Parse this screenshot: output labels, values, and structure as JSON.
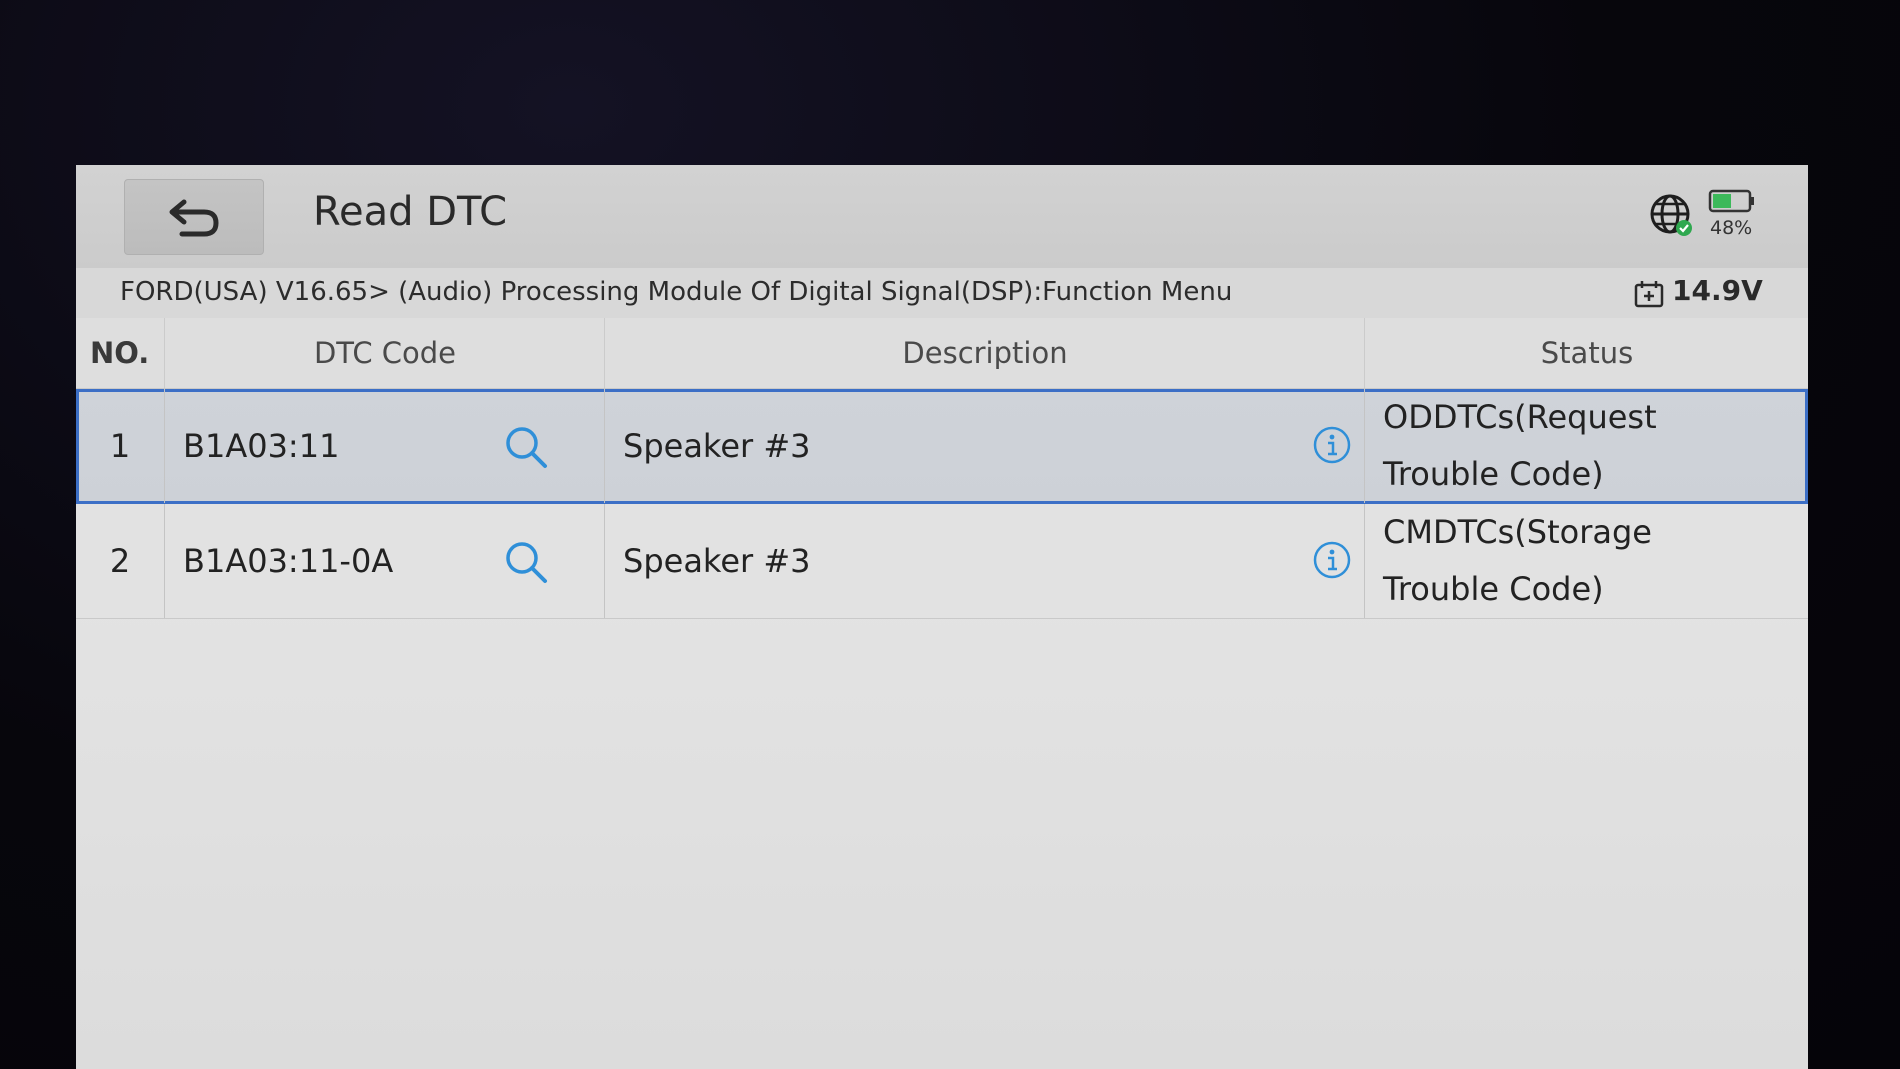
{
  "header": {
    "title": "Read DTC",
    "battery_percent": "48%"
  },
  "breadcrumb": {
    "path": "FORD(USA) V16.65> (Audio) Processing Module Of Digital Signal(DSP):Function Menu",
    "voltage": "14.9V"
  },
  "table": {
    "columns": [
      "NO.",
      "DTC Code",
      "Description",
      "Status"
    ],
    "rows": [
      {
        "no": "1",
        "code": "B1A03:11",
        "description": "Speaker #3",
        "status": "ODDTCs(Request Trouble Code)",
        "selected": true
      },
      {
        "no": "2",
        "code": "B1A03:11-0A",
        "description": "Speaker #3",
        "status": "CMDTCs(Storage Trouble Code)",
        "selected": false
      }
    ]
  },
  "colors": {
    "accent": "#3c6fc6",
    "icon_blue": "#2f8fd8"
  },
  "icons": {
    "back": "back-arrow-icon",
    "network": "globe-icon",
    "battery": "battery-icon",
    "voltage": "calendar-voltage-icon",
    "search": "search-icon",
    "info": "info-icon"
  }
}
